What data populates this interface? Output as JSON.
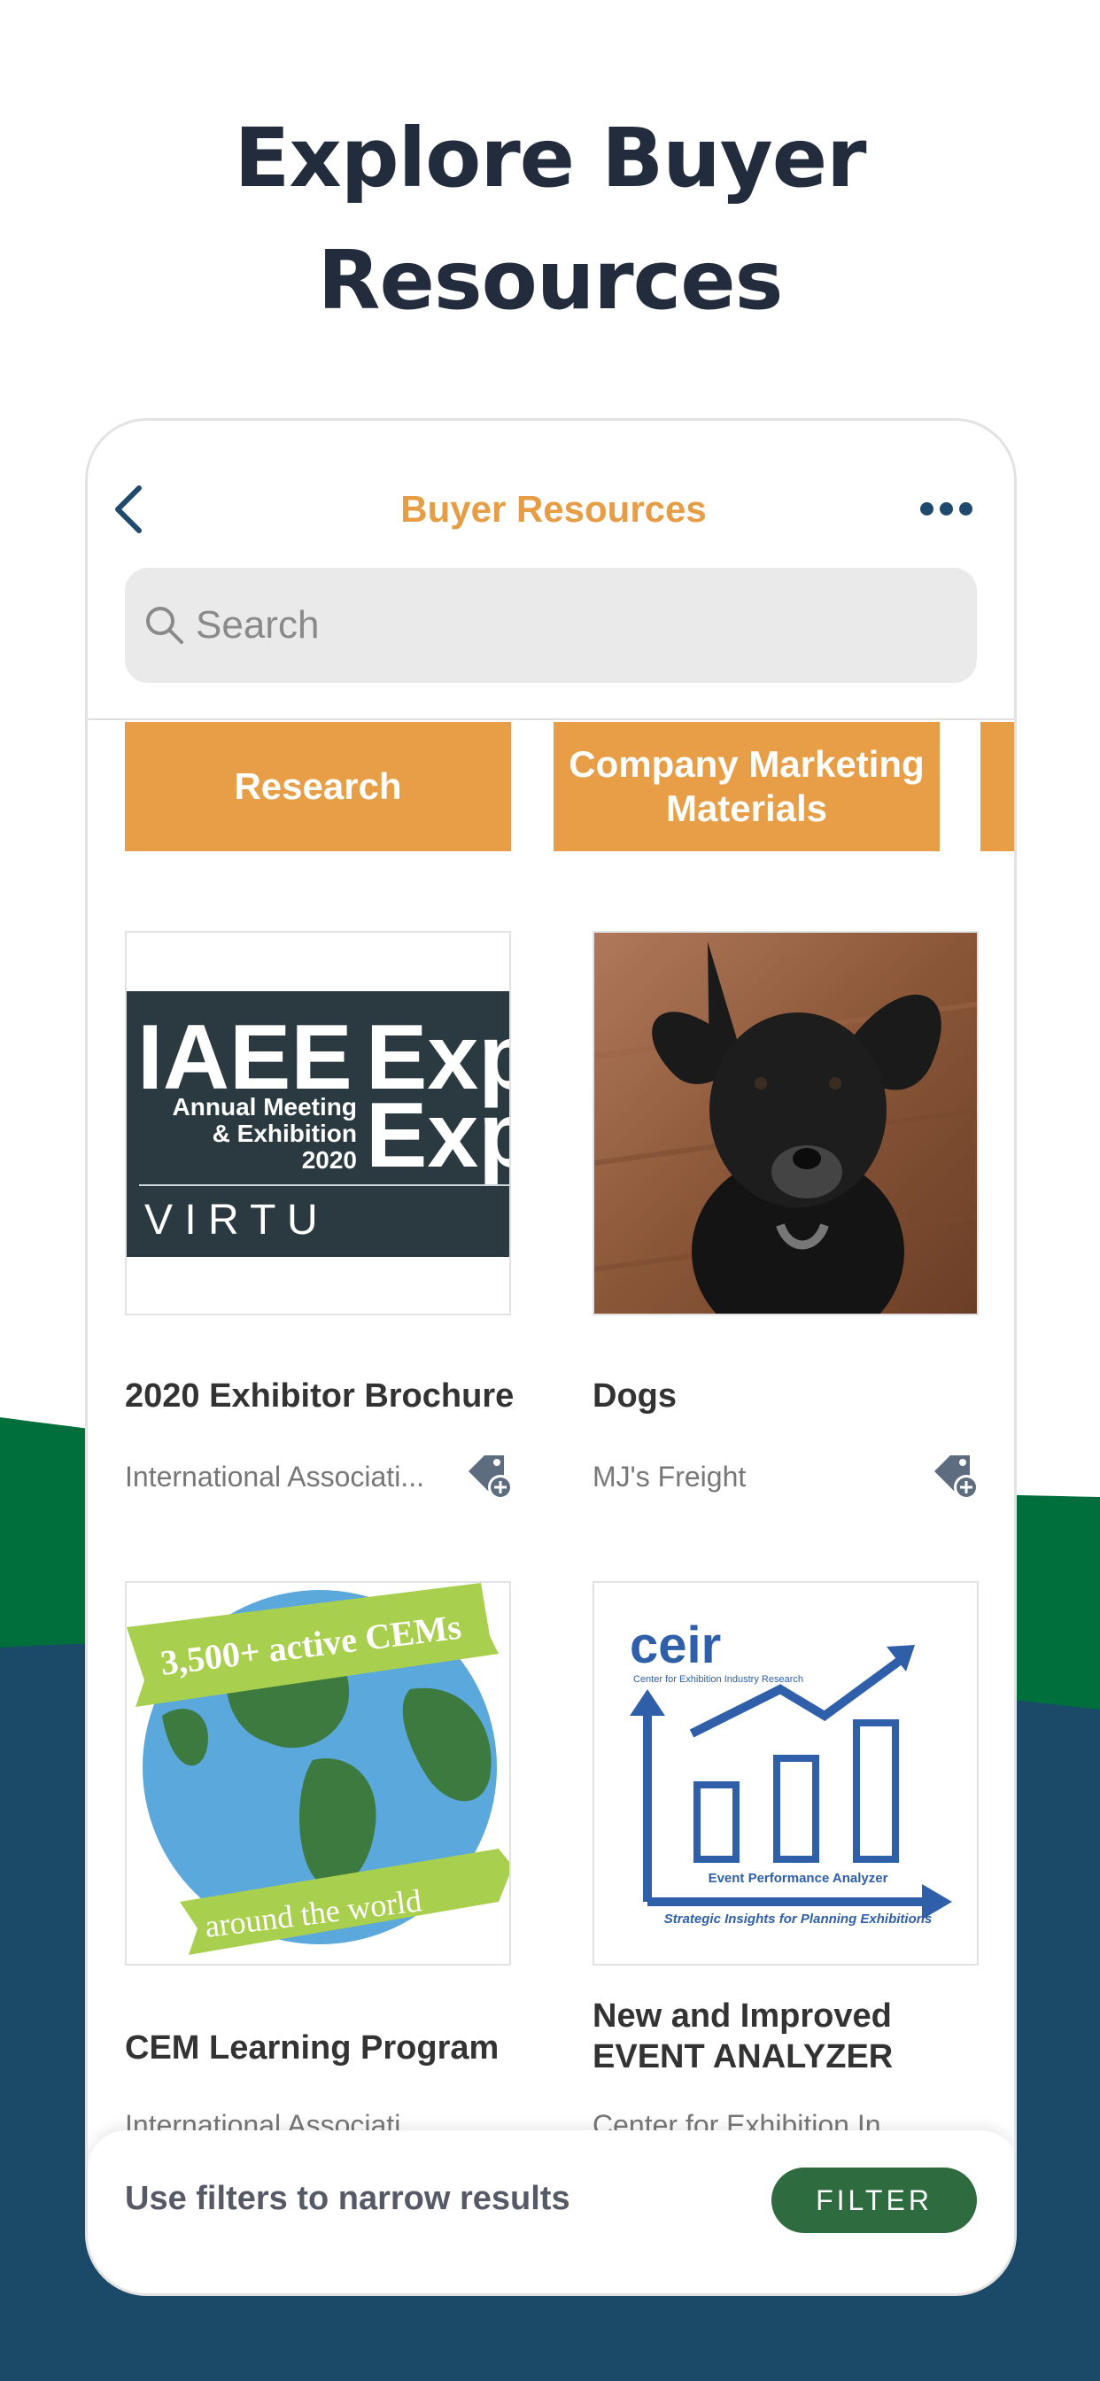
{
  "hero": {
    "title_line1": "Explore Buyer",
    "title_line2": "Resources"
  },
  "nav": {
    "title": "Buyer Resources",
    "back_icon": "chevron-left-icon",
    "more_icon": "more-horizontal-icon"
  },
  "search": {
    "placeholder": "Search"
  },
  "categories": [
    {
      "label": "Research"
    },
    {
      "label_line1": "Company Marketing",
      "label_line2": "Materials"
    }
  ],
  "cards": [
    {
      "title": "2020 Exhibitor Brochure",
      "subtitle": "International Associati...",
      "image_text": {
        "big": "IAEE",
        "big2a": "Exp",
        "big2b": "Exp",
        "line1": "Annual Meeting",
        "line2": "& Exhibition",
        "line3": "2020",
        "bottom": "V I R T U"
      }
    },
    {
      "title": "Dogs",
      "subtitle": "MJ's Freight"
    },
    {
      "title": "CEM Learning Program",
      "subtitle": "International Associati...",
      "image_text": {
        "top": "3,500+ active CEMs",
        "bottom": "around the world"
      }
    },
    {
      "title_line1": "New and Improved",
      "title_line2": "EVENT ANALYZER",
      "subtitle": "Center for Exhibition In...",
      "image_text": {
        "logo": "ceir",
        "logo_sub": "Center for Exhibition Industry Research",
        "caption1": "Event Performance Analyzer",
        "caption2": "Strategic Insights for Planning Exhibitions"
      }
    }
  ],
  "footer": {
    "hint": "Use filters to narrow results",
    "filter_label": "FILTER"
  },
  "colors": {
    "accent": "#e89e47",
    "navy": "#1a4a68",
    "green": "#006f3b",
    "filter_green": "#2e6b3f"
  }
}
